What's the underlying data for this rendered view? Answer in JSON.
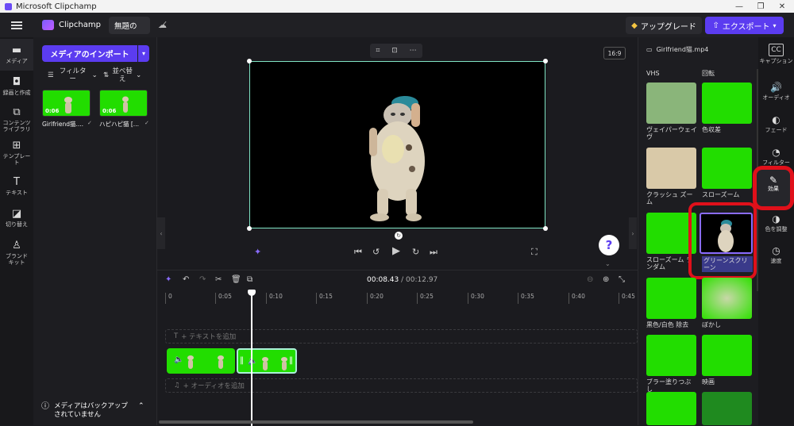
{
  "window": {
    "title": "Microsoft Clipchamp"
  },
  "header": {
    "brand": "Clipchamp",
    "project_name": "無題の　",
    "upgrade_label": "アップグレード",
    "export_label": "エクスポート"
  },
  "leftnav": [
    {
      "label": "メディア",
      "icon": "folder-icon"
    },
    {
      "label": "録画と作成",
      "icon": "record-icon"
    },
    {
      "label": "コンテンツ ライブラリ",
      "icon": "library-icon"
    },
    {
      "label": "テンプレート",
      "icon": "template-icon"
    },
    {
      "label": "テキスト",
      "icon": "text-icon"
    },
    {
      "label": "切り替え",
      "icon": "transition-icon"
    },
    {
      "label": "ブランド キット",
      "icon": "brand-icon"
    }
  ],
  "media": {
    "import_label": "メディアのインポート",
    "filter_label": "フィルター",
    "sort_label": "並べ替え",
    "items": [
      {
        "name": "Girlfriend猫....",
        "duration": "0:06"
      },
      {
        "name": "ハピハピ猫 [...",
        "duration": "0:06"
      }
    ],
    "backup_notice": "メディアはバックアップされていません"
  },
  "preview": {
    "aspect": "16:9"
  },
  "timeline": {
    "current_time": "00:08.43",
    "total_time": "00:12.97",
    "ticks": [
      "0",
      "0:05",
      "0:10",
      "0:15",
      "0:20",
      "0:25",
      "0:30",
      "0:35",
      "0:40",
      "0:45"
    ],
    "add_text": "+ テキストを追加",
    "add_audio": "+ オーディオを追加"
  },
  "effects": {
    "file_name": "Girlfriend猫.mp4",
    "items": [
      {
        "label": "VHS"
      },
      {
        "label": "回転"
      },
      {
        "label": "ヴェイパーウェイヴ"
      },
      {
        "label": "色収差"
      },
      {
        "label": "クラッシュ ズーム"
      },
      {
        "label": "スローズーム"
      },
      {
        "label": "スローズーム ランダム"
      },
      {
        "label": "グリーンスクリーン"
      },
      {
        "label": "黒色/白色 除去"
      },
      {
        "label": "ぼかし"
      },
      {
        "label": "ブラー塗りつぶし"
      },
      {
        "label": "映画"
      }
    ]
  },
  "rightrail": [
    {
      "label": "キャプション",
      "icon": "cc-icon"
    },
    {
      "label": "オーディオ",
      "icon": "speaker-icon"
    },
    {
      "label": "フェード",
      "icon": "fade-icon"
    },
    {
      "label": "フィルター",
      "icon": "filter-icon"
    },
    {
      "label": "効果",
      "icon": "magic-wand-icon"
    },
    {
      "label": "色を調整",
      "icon": "color-icon"
    },
    {
      "label": "速度",
      "icon": "speed-icon"
    }
  ],
  "colors": {
    "accent": "#5b3cf0",
    "green": "#22dd00",
    "highlight": "#e0101a"
  }
}
